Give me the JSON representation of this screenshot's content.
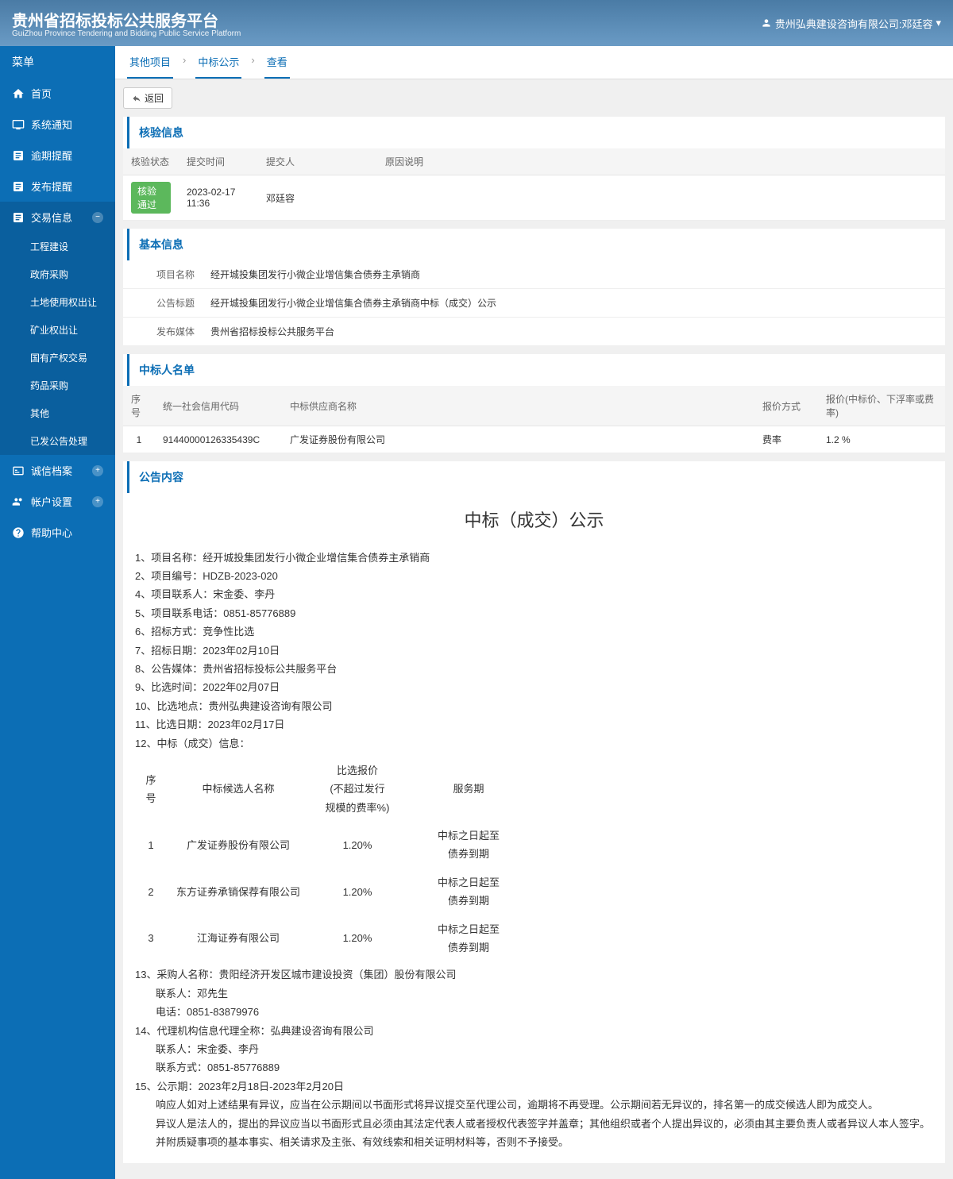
{
  "header": {
    "title": "贵州省招标投标公共服务平台",
    "subtitle": "GuiZhou Province Tendering and Bidding Public Service Platform",
    "user": "贵州弘典建设咨询有限公司:邓廷容"
  },
  "sidebar": {
    "title": "菜单",
    "items": [
      {
        "label": "首页",
        "icon": "home"
      },
      {
        "label": "系统通知",
        "icon": "monitor"
      },
      {
        "label": "逾期提醒",
        "icon": "doc"
      },
      {
        "label": "发布提醒",
        "icon": "doc"
      },
      {
        "label": "交易信息",
        "icon": "doc",
        "active": true,
        "expanded": true,
        "children": [
          {
            "label": "工程建设"
          },
          {
            "label": "政府采购"
          },
          {
            "label": "土地使用权出让"
          },
          {
            "label": "矿业权出让"
          },
          {
            "label": "国有产权交易"
          },
          {
            "label": "药品采购"
          },
          {
            "label": "其他"
          },
          {
            "label": "已发公告处理"
          }
        ]
      },
      {
        "label": "诚信档案",
        "icon": "card",
        "hasExpand": true
      },
      {
        "label": "帐户设置",
        "icon": "users",
        "hasExpand": true
      },
      {
        "label": "帮助中心",
        "icon": "help"
      }
    ]
  },
  "breadcrumb": {
    "items": [
      "其他项目",
      "中标公示",
      "查看"
    ]
  },
  "backBtn": "返回",
  "verify": {
    "title": "核验信息",
    "headers": [
      "核验状态",
      "提交时间",
      "提交人",
      "原因说明"
    ],
    "row": {
      "status": "核验通过",
      "time": "2023-02-17 11:36",
      "submitter": "邓廷容",
      "reason": ""
    }
  },
  "basic": {
    "title": "基本信息",
    "rows": [
      {
        "label": "项目名称",
        "value": "经开城投集团发行小微企业增信集合债券主承销商"
      },
      {
        "label": "公告标题",
        "value": "经开城投集团发行小微企业增信集合债券主承销商中标（成交）公示"
      },
      {
        "label": "发布媒体",
        "value": "贵州省招标投标公共服务平台"
      }
    ]
  },
  "winners": {
    "title": "中标人名单",
    "headers": [
      "序号",
      "统一社会信用代码",
      "中标供应商名称",
      "报价方式",
      "报价(中标价、下浮率或费率)"
    ],
    "rows": [
      {
        "no": "1",
        "code": "91440000126335439C",
        "name": "广发证券股份有限公司",
        "method": "费率",
        "price": "1.2 %"
      }
    ]
  },
  "announce": {
    "title": "公告内容",
    "heading": "中标（成交）公示",
    "lines": [
      "1、项目名称：经开城投集团发行小微企业增信集合债券主承销商",
      "2、项目编号：HDZB-2023-020",
      "4、项目联系人：宋金委、李丹",
      "5、项目联系电话：0851-85776889",
      "6、招标方式：竞争性比选",
      "7、招标日期：2023年02月10日",
      "8、公告媒体：贵州省招标投标公共服务平台",
      "9、比选时间：2022年02月07日",
      "10、比选地点：贵州弘典建设咨询有限公司",
      "11、比选日期：2023年02月17日",
      "12、中标（成交）信息："
    ],
    "resultHeaders": [
      "序号",
      "中标候选人名称",
      "比选报价\n(不超过发行\n规模的费率%)",
      "服务期"
    ],
    "resultRows": [
      {
        "no": "1",
        "name": "广发证券股份有限公司",
        "rate": "1.20%",
        "period": "中标之日起至债券到期"
      },
      {
        "no": "2",
        "name": "东方证券承销保荐有限公司",
        "rate": "1.20%",
        "period": "中标之日起至债券到期"
      },
      {
        "no": "3",
        "name": "江海证券有限公司",
        "rate": "1.20%",
        "period": "中标之日起至债券到期"
      }
    ],
    "footer": {
      "l13": "13、采购人名称：贵阳经济开发区城市建设投资（集团）股份有限公司",
      "l13a": "联系人：邓先生",
      "l13b": "电话：0851-83879976",
      "l14": "14、代理机构信息代理全称：弘典建设咨询有限公司",
      "l14a": "联系人：宋金委、李丹",
      "l14b": "联系方式：0851-85776889",
      "l15": "15、公示期：2023年2月18日-2023年2月20日",
      "l15a": "响应人如对上述结果有异议，应当在公示期间以书面形式将异议提交至代理公司，逾期将不再受理。公示期间若无异议的，排名第一的成交候选人即为成交人。",
      "l15b": "异议人是法人的，提出的异议应当以书面形式且必须由其法定代表人或者授权代表签字并盖章；其他组织或者个人提出异议的，必须由其主要负责人或者异议人本人签字。并附质疑事项的基本事实、相关请求及主张、有效线索和相关证明材料等，否则不予接受。"
    }
  }
}
